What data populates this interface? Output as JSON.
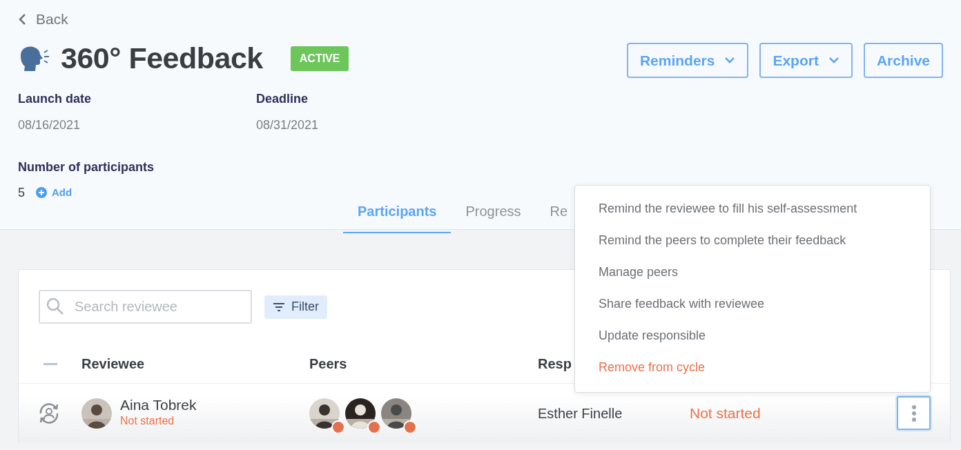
{
  "back": {
    "label": "Back"
  },
  "title": "360° Feedback",
  "status_badge": "ACTIVE",
  "actions": [
    {
      "label": "Reminders",
      "dropdown": true
    },
    {
      "label": "Export",
      "dropdown": true
    },
    {
      "label": "Archive",
      "dropdown": false
    }
  ],
  "details": [
    {
      "label": "Launch date",
      "value": "08/16/2021"
    },
    {
      "label": "Deadline",
      "value": "08/31/2021"
    }
  ],
  "participants": {
    "label": "Number of participants",
    "count": "5",
    "add_label": "Add"
  },
  "tabs": [
    {
      "label": "Participants",
      "selected": true
    },
    {
      "label": "Progress",
      "selected": false
    },
    {
      "label": "Re",
      "selected": false
    }
  ],
  "search": {
    "placeholder": "Search reviewee"
  },
  "filter_button": "Filter",
  "table": {
    "columns": [
      "Reviewee",
      "Peers",
      "Resp"
    ],
    "rows": [
      {
        "reviewee": "Aina Tobrek",
        "reviewee_status": "Not started",
        "responsible": "Esther Finelle",
        "status": "Not started"
      }
    ]
  },
  "row_menu": {
    "items": [
      {
        "label": "Remind the reviewee to fill his self-assessment",
        "kind": "normal"
      },
      {
        "label": "Remind the peers to complete their feedback",
        "kind": "normal"
      },
      {
        "label": "Manage peers",
        "kind": "normal"
      },
      {
        "label": "Share feedback with reviewee",
        "kind": "normal"
      },
      {
        "label": "Update responsible",
        "kind": "normal"
      },
      {
        "label": "Remove from cycle",
        "kind": "danger"
      }
    ]
  }
}
